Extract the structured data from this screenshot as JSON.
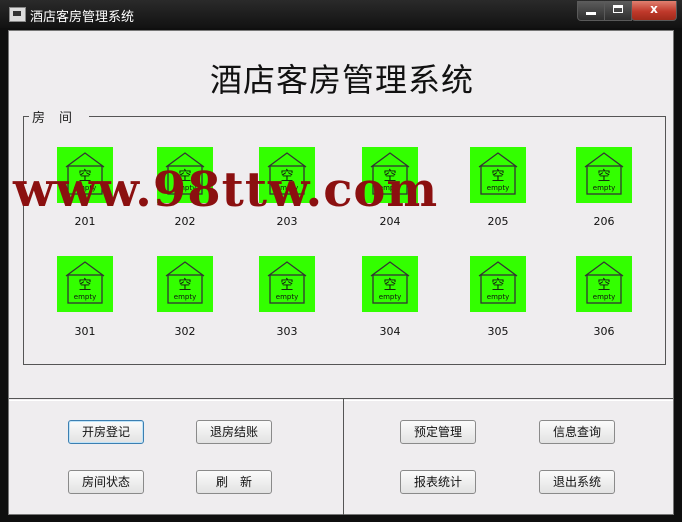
{
  "window": {
    "title": "酒店客房管理系统"
  },
  "controls": {
    "minimize": "minimize",
    "maximize": "maximize",
    "close": "x"
  },
  "main": {
    "heading": "酒店客房管理系统",
    "room_panel_title": "房间",
    "watermark": "www.98ttw.com",
    "room_icon": {
      "char": "空",
      "label": "empty",
      "icon": "house-icon",
      "color": "#33ff00"
    },
    "rooms_row1": [
      "201",
      "202",
      "203",
      "204",
      "205",
      "206"
    ],
    "rooms_row2": [
      "301",
      "302",
      "303",
      "304",
      "305",
      "306"
    ]
  },
  "buttons": {
    "checkin": "开房登记",
    "checkout": "退房结账",
    "room_status": "房间状态",
    "refresh": "刷　新",
    "reservation": "预定管理",
    "info_query": "信息查询",
    "report": "报表统计",
    "exit": "退出系统"
  }
}
